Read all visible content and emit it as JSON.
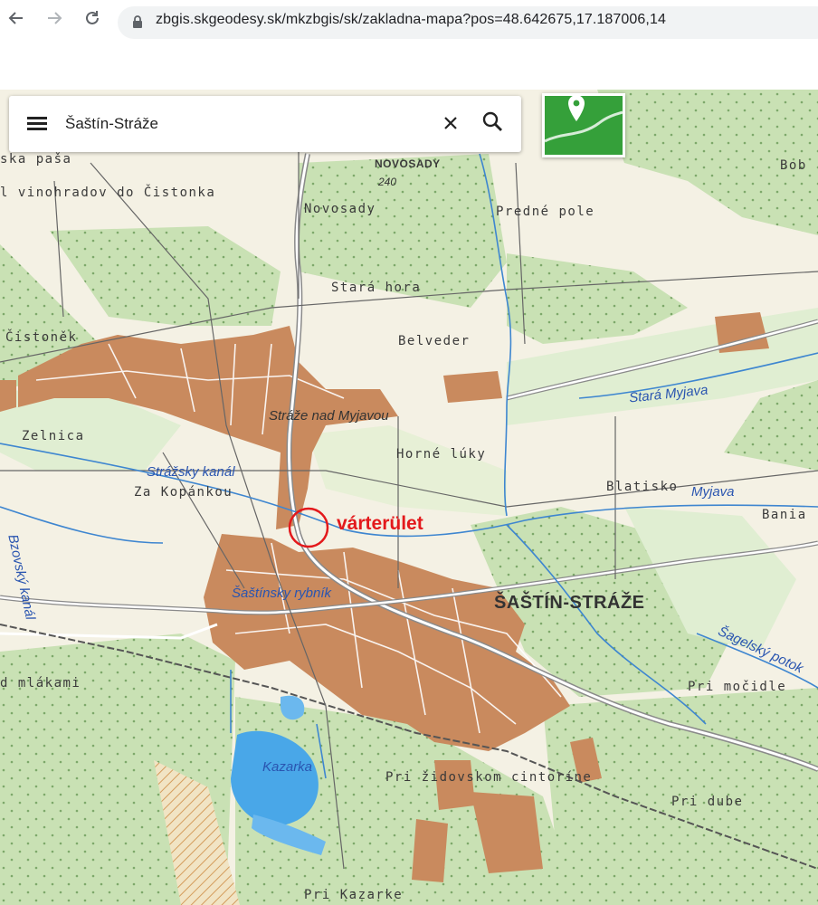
{
  "browser": {
    "url": "zbgis.skgeodesy.sk/mkzbgis/sk/zakladna-mapa?pos=48.642675,17.187006,14",
    "back_icon": "back-arrow-icon",
    "forward_icon": "forward-arrow-icon",
    "reload_icon": "reload-icon",
    "lock_icon": "lock-icon"
  },
  "search": {
    "query": "Šaštín-Stráže",
    "menu_icon": "hamburger-menu-icon",
    "clear_icon": "close-icon",
    "search_icon": "search-icon"
  },
  "layer_button": {
    "icon": "map-pin-icon"
  },
  "annotation": {
    "label": "várterület",
    "color": "#e3191c"
  },
  "map": {
    "colors": {
      "background": "#f4f1e4",
      "forest": "#c9e1b4",
      "urban": "#c98a5e",
      "water": "#49a7e8",
      "pasture": "#e0eed2"
    },
    "labels": {
      "ska_pasa": "ska paša",
      "vinohradov": "l vinohradov do Čistonka",
      "novosady_caps": "NOVOSADY",
      "elev_240": "240",
      "novosady": "Novosady",
      "predne_pole": "Predné pole",
      "bob": "Bob",
      "stara_hora": "Stará hora",
      "cistonek": "Čistoněk",
      "belveder": "Belveder",
      "straze": "Stráže nad Myjavou",
      "stara_myjava": "Stará Myjava",
      "zelnica": "Zelnica",
      "horne_luky": "Horné lúky",
      "strazsky_kanal": "Strážsky kanál",
      "za_kopankou": "Za Kopánkou",
      "blatisko": "Blatisko",
      "myjava": "Myjava",
      "bania": "Bania",
      "bzovsky_kanal": "Bzovský kanál",
      "sastinsky_rybnik": "Šaštínsky rybník",
      "sastin_straze": "ŠAŠTÍN-STRÁŽE",
      "sagelsky_potok": "Šagelský potok",
      "mlakami": "d mlákami",
      "pri_mocidle": "Pri močidle",
      "kazarka": "Kazarka",
      "pri_zidovskom": "Pri židovskom cintoríne",
      "pri_dube": "Pri dube",
      "pri_kazarke": "Pri Kazarke"
    }
  }
}
